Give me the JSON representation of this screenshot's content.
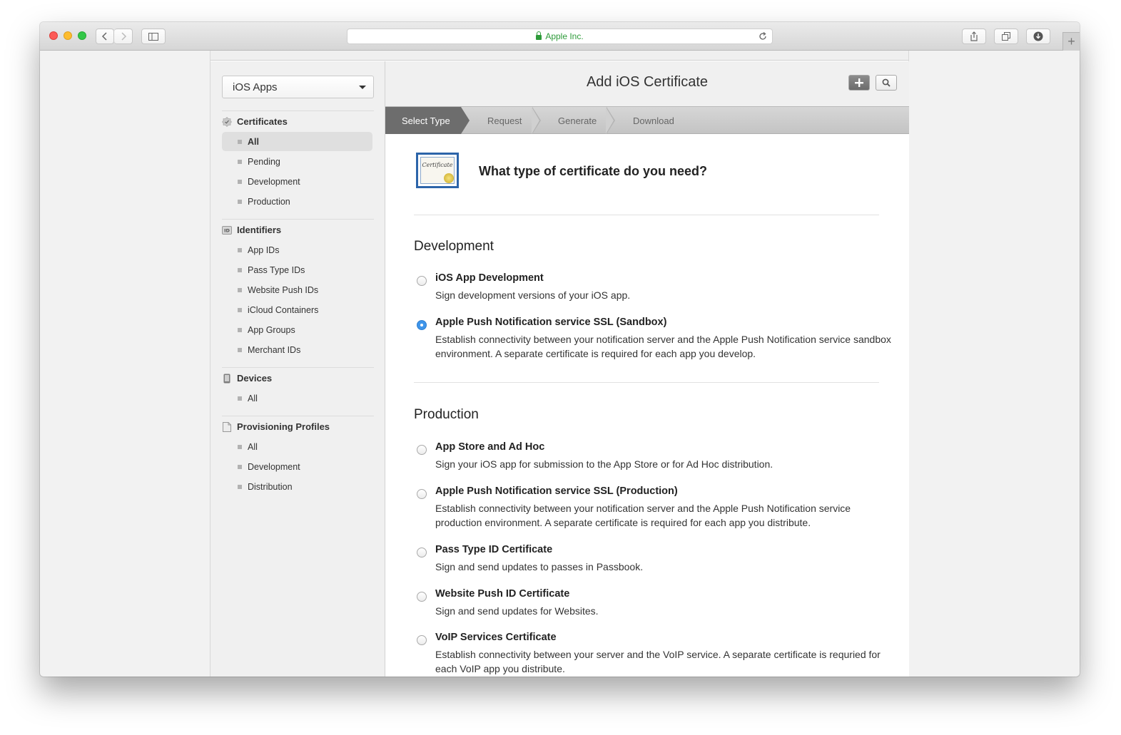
{
  "browser": {
    "address": "Apple Inc.",
    "new_tab": "+"
  },
  "sidebar": {
    "selector": "iOS Apps",
    "sections": [
      {
        "title": "Certificates",
        "items": [
          "All",
          "Pending",
          "Development",
          "Production"
        ]
      },
      {
        "title": "Identifiers",
        "items": [
          "App IDs",
          "Pass Type IDs",
          "Website Push IDs",
          "iCloud Containers",
          "App Groups",
          "Merchant IDs"
        ]
      },
      {
        "title": "Devices",
        "items": [
          "All"
        ]
      },
      {
        "title": "Provisioning Profiles",
        "items": [
          "All",
          "Development",
          "Distribution"
        ]
      }
    ],
    "active": "Certificates/All"
  },
  "main": {
    "title": "Add iOS Certificate",
    "steps": [
      "Select Type",
      "Request",
      "Generate",
      "Download"
    ],
    "active_step": "Select Type",
    "question": "What type of certificate do you need?",
    "certificate_image_text": "Certificate",
    "groups": [
      {
        "title": "Development",
        "options": [
          {
            "title": "iOS App Development",
            "description": "Sign development versions of your iOS app.",
            "selected": false
          },
          {
            "title": "Apple Push Notification service SSL (Sandbox)",
            "description": "Establish connectivity between your notification server and the Apple Push Notification service sandbox environment. A separate certificate is required for each app you develop.",
            "selected": true
          }
        ]
      },
      {
        "title": "Production",
        "options": [
          {
            "title": "App Store and Ad Hoc",
            "description": "Sign your iOS app for submission to the App Store or for Ad Hoc distribution.",
            "selected": false
          },
          {
            "title": "Apple Push Notification service SSL (Production)",
            "description": "Establish connectivity between your notification server and the Apple Push Notification service production environment. A separate certificate is required for each app you distribute.",
            "selected": false
          },
          {
            "title": "Pass Type ID Certificate",
            "description": "Sign and send updates to passes in Passbook.",
            "selected": false
          },
          {
            "title": "Website Push ID Certificate",
            "description": "Sign and send updates for Websites.",
            "selected": false
          },
          {
            "title": "VoIP Services Certificate",
            "description": "Establish connectivity between your server and the VoIP service. A separate certificate is requried for each VoIP app you distribute.",
            "selected": false
          }
        ]
      }
    ]
  },
  "colors": {
    "selected_radio": "#3e95ea",
    "active_step": "#6d6d6d",
    "secure_address": "#2e9b3a"
  }
}
